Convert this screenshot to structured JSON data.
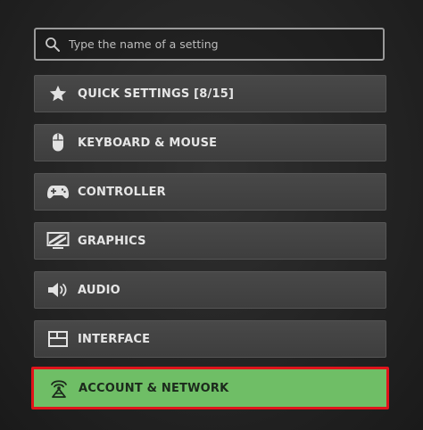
{
  "search": {
    "placeholder": "Type the name of a setting",
    "icon": "search-icon"
  },
  "menu": {
    "items": [
      {
        "label": "QUICK SETTINGS [8/15]",
        "icon": "star-icon"
      },
      {
        "label": "KEYBOARD & MOUSE",
        "icon": "mouse-icon"
      },
      {
        "label": "CONTROLLER",
        "icon": "gamepad-icon"
      },
      {
        "label": "GRAPHICS",
        "icon": "monitor-icon"
      },
      {
        "label": "AUDIO",
        "icon": "speaker-icon"
      },
      {
        "label": "INTERFACE",
        "icon": "layout-icon"
      },
      {
        "label": "ACCOUNT & NETWORK",
        "icon": "network-icon",
        "selected": true
      }
    ]
  },
  "colors": {
    "selected_background": "#6fbe66",
    "selected_outline": "#e0141b",
    "item_background": "#444444",
    "text": "#e6e6e6"
  }
}
